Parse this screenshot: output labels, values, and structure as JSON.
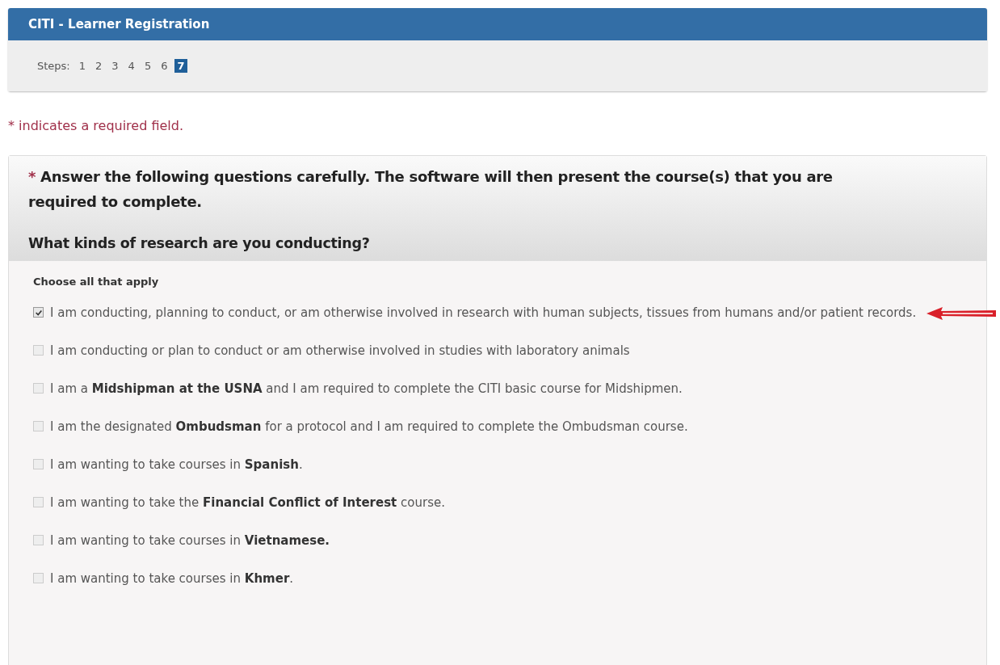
{
  "header": {
    "title": "CITI - Learner Registration"
  },
  "steps": {
    "label": "Steps:",
    "items": [
      {
        "label": "1",
        "selected": false
      },
      {
        "label": "2",
        "selected": false
      },
      {
        "label": "3",
        "selected": false
      },
      {
        "label": "4",
        "selected": false
      },
      {
        "label": "5",
        "selected": false
      },
      {
        "label": "6",
        "selected": false
      },
      {
        "label": "7",
        "selected": true
      }
    ]
  },
  "required_note": {
    "mark": "*",
    "text": "indicates a required field."
  },
  "question_card": {
    "mark": "*",
    "instruction": "Answer the following questions carefully. The software will then present the course(s) that you are required to complete.",
    "question": "What kinds of research are you conducting?",
    "hint": "Choose all that apply",
    "options": [
      {
        "text": "I am conducting, planning to conduct, or am otherwise involved in research with human subjects, tissues from humans and/or patient records.",
        "checked": true,
        "annotated": true
      },
      {
        "text": "I am conducting or plan to conduct or am otherwise involved in studies with laboratory animals",
        "checked": false,
        "annotated": false
      },
      {
        "text": "I am a **Midshipman at the USNA** and I am required to complete the CITI basic course for Midshipmen.",
        "checked": false,
        "annotated": false
      },
      {
        "text": "I am the designated **Ombudsman** for a protocol and I am required to complete the Ombudsman course.",
        "checked": false,
        "annotated": false
      },
      {
        "text": "I am wanting to take courses in **Spanish**.",
        "checked": false,
        "annotated": false
      },
      {
        "text": "I am wanting to take the **Financial Conflict of Interest** course.",
        "checked": false,
        "annotated": false
      },
      {
        "text": "I am wanting to take courses in **Vietnamese.**",
        "checked": false,
        "annotated": false
      },
      {
        "text": "I am wanting to take courses in **Khmer**.",
        "checked": false,
        "annotated": false
      }
    ]
  }
}
